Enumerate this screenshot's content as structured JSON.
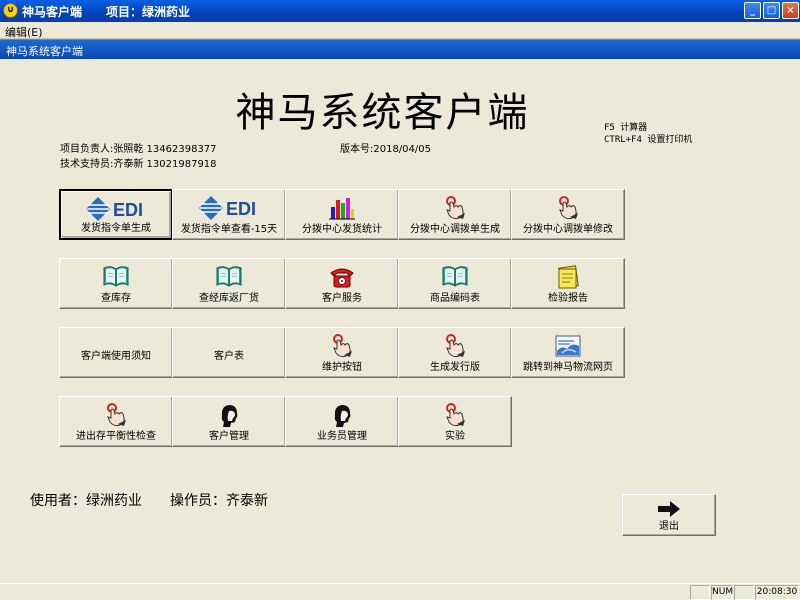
{
  "window": {
    "app_icon_glyph": "∪",
    "title": "神马客户端　　项目：绿洲药业",
    "controls": {
      "minimize": "_",
      "maximize": "□",
      "close": "×"
    }
  },
  "menu": {
    "items": [
      {
        "label": "编辑(E)"
      }
    ]
  },
  "child_window": {
    "title": "神马系统客户端"
  },
  "header": {
    "title": "神马系统客户端",
    "project_lead": "项目负责人:张照乾 13462398377",
    "tech_support": "技术支持员:齐泰新 13021987918",
    "version": "版本号:2018/04/05",
    "shortcut_calc": "F5 计算器",
    "shortcut_printer": "CTRL+F4 设置打印机"
  },
  "tiles": {
    "r1": [
      "发货指令单生成",
      "发货指令单查看-15天",
      "分拨中心发货统计",
      "分拨中心调拨单生成",
      "分拨中心调拨单修改"
    ],
    "r2": [
      "查库存",
      "查经库返厂货",
      "客户服务",
      "商品编码表",
      "检验报告"
    ],
    "r3": [
      "客户端使用须知",
      "客户表",
      "维护按钮",
      "生成发行版",
      "跳转到神马物流网页"
    ],
    "r4": [
      "进出存平衡性检查",
      "客户管理",
      "业务员管理",
      "实验"
    ],
    "edi_text": "EDI"
  },
  "footer": {
    "user": "使用者：绿洲药业",
    "operator": "操作员：齐泰新",
    "exit_label": "退出"
  },
  "status": {
    "num": "NUM",
    "time": "20:08:30"
  },
  "colors": {
    "titlebar": "#0A5FE4",
    "panel": "#ECE9D8",
    "edi_blue": "#1F4E9C",
    "phone_red": "#D81E1E"
  }
}
